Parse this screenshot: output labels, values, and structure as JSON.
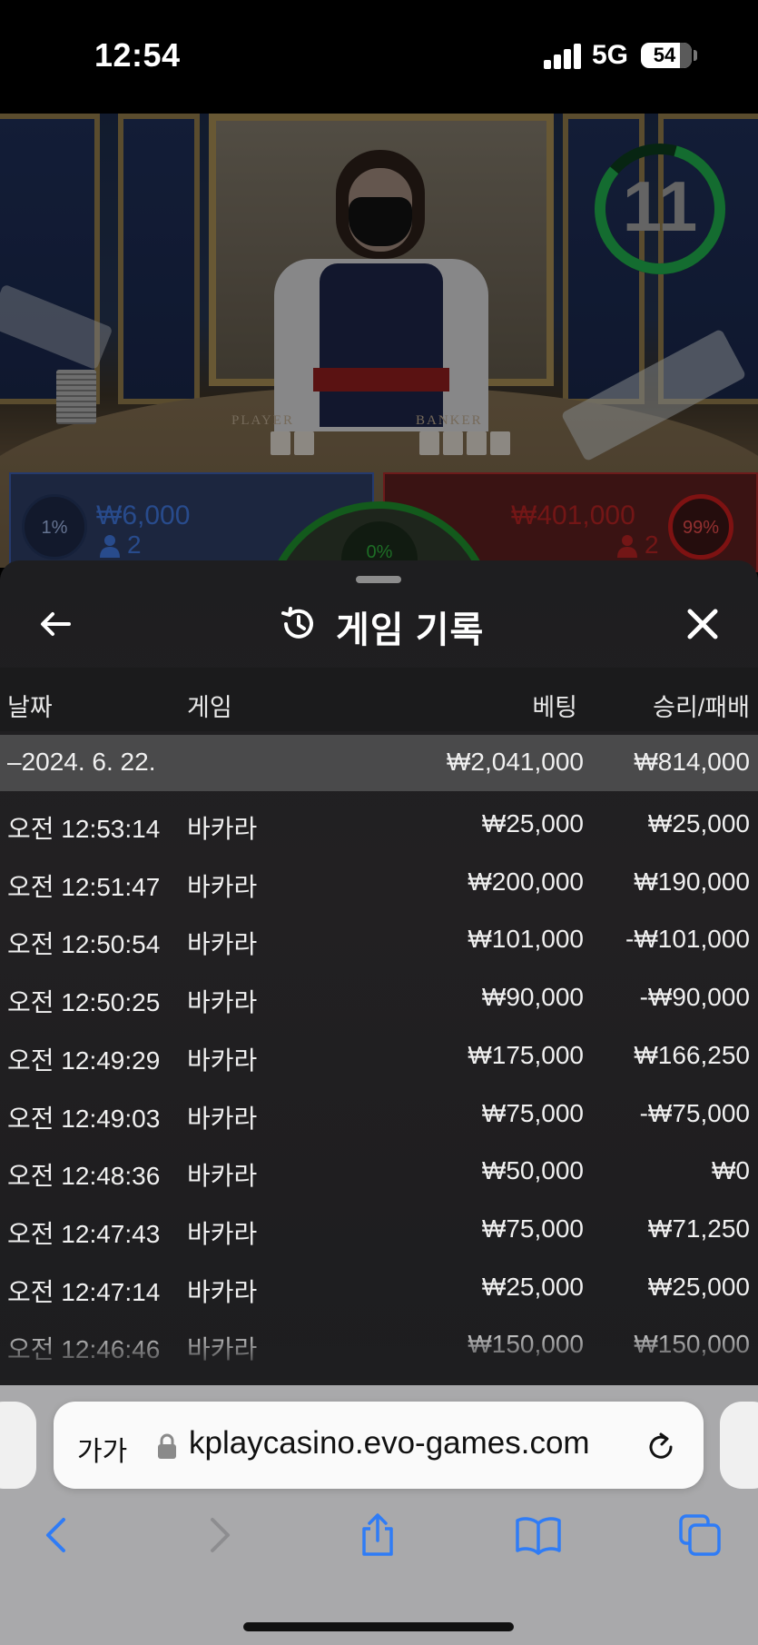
{
  "status_bar": {
    "time": "12:54",
    "network": "5G",
    "battery": "54"
  },
  "game": {
    "timer": "11",
    "table_labels": [
      "PLAYER",
      "BANKER"
    ],
    "player": {
      "percent": "1%",
      "amount": "₩6,000",
      "count": "2"
    },
    "banker": {
      "percent": "99%",
      "amount": "₩401,000",
      "count": "2"
    },
    "tie": {
      "percent": "0%"
    },
    "colors": {
      "player": "#3e74d8",
      "banker": "#b12222",
      "timer": "#1fa64a",
      "tie": "#2da83a"
    }
  },
  "sheet": {
    "title": "게임 기록",
    "icons": [
      "back-arrow-icon",
      "history-icon",
      "close-icon"
    ],
    "columns": {
      "date": "날짜",
      "game": "게임",
      "bet": "베팅",
      "win_loss": "승리/패배"
    },
    "date_group": {
      "label": "–2024. 6. 22.",
      "bet_total": "₩2,041,000",
      "win_total": "₩814,000"
    },
    "rows": [
      {
        "time": "오전 12:53:14",
        "game": "바카라",
        "bet": "₩25,000",
        "result": "₩25,000"
      },
      {
        "time": "오전 12:51:47",
        "game": "바카라",
        "bet": "₩200,000",
        "result": "₩190,000"
      },
      {
        "time": "오전 12:50:54",
        "game": "바카라",
        "bet": "₩101,000",
        "result": "-₩101,000"
      },
      {
        "time": "오전 12:50:25",
        "game": "바카라",
        "bet": "₩90,000",
        "result": "-₩90,000"
      },
      {
        "time": "오전 12:49:29",
        "game": "바카라",
        "bet": "₩175,000",
        "result": "₩166,250"
      },
      {
        "time": "오전 12:49:03",
        "game": "바카라",
        "bet": "₩75,000",
        "result": "-₩75,000"
      },
      {
        "time": "오전 12:48:36",
        "game": "바카라",
        "bet": "₩50,000",
        "result": "₩0"
      },
      {
        "time": "오전 12:47:43",
        "game": "바카라",
        "bet": "₩75,000",
        "result": "₩71,250"
      },
      {
        "time": "오전 12:47:14",
        "game": "바카라",
        "bet": "₩25,000",
        "result": "₩25,000"
      },
      {
        "time": "오전 12:46:46",
        "game": "바카라",
        "bet": "₩150,000",
        "result": "₩150,000"
      }
    ]
  },
  "browser": {
    "text_size_label": "가가",
    "url": "kplaycasino.evo-games.com",
    "nav_icons": [
      "back-icon",
      "forward-icon",
      "share-icon",
      "bookmarks-icon",
      "tabs-icon"
    ],
    "accent": "#2f7cf6"
  }
}
